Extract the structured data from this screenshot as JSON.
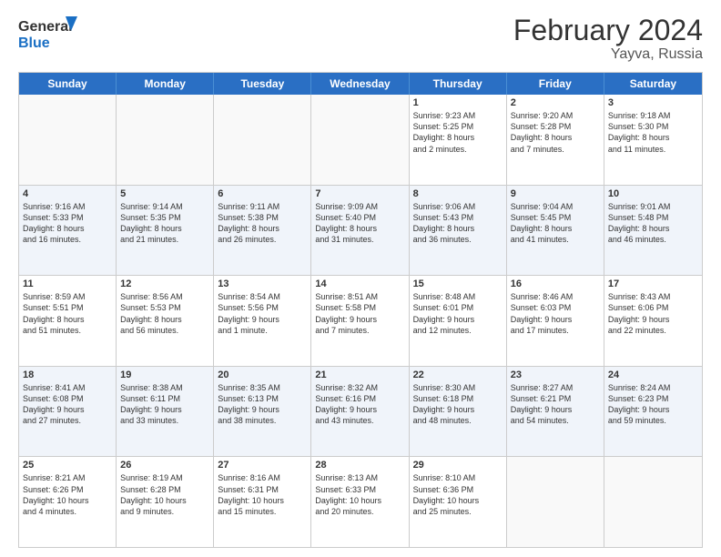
{
  "logo": {
    "line1": "General",
    "line2": "Blue"
  },
  "title": "February 2024",
  "location": "Yayva, Russia",
  "header_days": [
    "Sunday",
    "Monday",
    "Tuesday",
    "Wednesday",
    "Thursday",
    "Friday",
    "Saturday"
  ],
  "rows": [
    [
      {
        "day": "",
        "info": ""
      },
      {
        "day": "",
        "info": ""
      },
      {
        "day": "",
        "info": ""
      },
      {
        "day": "",
        "info": ""
      },
      {
        "day": "1",
        "info": "Sunrise: 9:23 AM\nSunset: 5:25 PM\nDaylight: 8 hours\nand 2 minutes."
      },
      {
        "day": "2",
        "info": "Sunrise: 9:20 AM\nSunset: 5:28 PM\nDaylight: 8 hours\nand 7 minutes."
      },
      {
        "day": "3",
        "info": "Sunrise: 9:18 AM\nSunset: 5:30 PM\nDaylight: 8 hours\nand 11 minutes."
      }
    ],
    [
      {
        "day": "4",
        "info": "Sunrise: 9:16 AM\nSunset: 5:33 PM\nDaylight: 8 hours\nand 16 minutes."
      },
      {
        "day": "5",
        "info": "Sunrise: 9:14 AM\nSunset: 5:35 PM\nDaylight: 8 hours\nand 21 minutes."
      },
      {
        "day": "6",
        "info": "Sunrise: 9:11 AM\nSunset: 5:38 PM\nDaylight: 8 hours\nand 26 minutes."
      },
      {
        "day": "7",
        "info": "Sunrise: 9:09 AM\nSunset: 5:40 PM\nDaylight: 8 hours\nand 31 minutes."
      },
      {
        "day": "8",
        "info": "Sunrise: 9:06 AM\nSunset: 5:43 PM\nDaylight: 8 hours\nand 36 minutes."
      },
      {
        "day": "9",
        "info": "Sunrise: 9:04 AM\nSunset: 5:45 PM\nDaylight: 8 hours\nand 41 minutes."
      },
      {
        "day": "10",
        "info": "Sunrise: 9:01 AM\nSunset: 5:48 PM\nDaylight: 8 hours\nand 46 minutes."
      }
    ],
    [
      {
        "day": "11",
        "info": "Sunrise: 8:59 AM\nSunset: 5:51 PM\nDaylight: 8 hours\nand 51 minutes."
      },
      {
        "day": "12",
        "info": "Sunrise: 8:56 AM\nSunset: 5:53 PM\nDaylight: 8 hours\nand 56 minutes."
      },
      {
        "day": "13",
        "info": "Sunrise: 8:54 AM\nSunset: 5:56 PM\nDaylight: 9 hours\nand 1 minute."
      },
      {
        "day": "14",
        "info": "Sunrise: 8:51 AM\nSunset: 5:58 PM\nDaylight: 9 hours\nand 7 minutes."
      },
      {
        "day": "15",
        "info": "Sunrise: 8:48 AM\nSunset: 6:01 PM\nDaylight: 9 hours\nand 12 minutes."
      },
      {
        "day": "16",
        "info": "Sunrise: 8:46 AM\nSunset: 6:03 PM\nDaylight: 9 hours\nand 17 minutes."
      },
      {
        "day": "17",
        "info": "Sunrise: 8:43 AM\nSunset: 6:06 PM\nDaylight: 9 hours\nand 22 minutes."
      }
    ],
    [
      {
        "day": "18",
        "info": "Sunrise: 8:41 AM\nSunset: 6:08 PM\nDaylight: 9 hours\nand 27 minutes."
      },
      {
        "day": "19",
        "info": "Sunrise: 8:38 AM\nSunset: 6:11 PM\nDaylight: 9 hours\nand 33 minutes."
      },
      {
        "day": "20",
        "info": "Sunrise: 8:35 AM\nSunset: 6:13 PM\nDaylight: 9 hours\nand 38 minutes."
      },
      {
        "day": "21",
        "info": "Sunrise: 8:32 AM\nSunset: 6:16 PM\nDaylight: 9 hours\nand 43 minutes."
      },
      {
        "day": "22",
        "info": "Sunrise: 8:30 AM\nSunset: 6:18 PM\nDaylight: 9 hours\nand 48 minutes."
      },
      {
        "day": "23",
        "info": "Sunrise: 8:27 AM\nSunset: 6:21 PM\nDaylight: 9 hours\nand 54 minutes."
      },
      {
        "day": "24",
        "info": "Sunrise: 8:24 AM\nSunset: 6:23 PM\nDaylight: 9 hours\nand 59 minutes."
      }
    ],
    [
      {
        "day": "25",
        "info": "Sunrise: 8:21 AM\nSunset: 6:26 PM\nDaylight: 10 hours\nand 4 minutes."
      },
      {
        "day": "26",
        "info": "Sunrise: 8:19 AM\nSunset: 6:28 PM\nDaylight: 10 hours\nand 9 minutes."
      },
      {
        "day": "27",
        "info": "Sunrise: 8:16 AM\nSunset: 6:31 PM\nDaylight: 10 hours\nand 15 minutes."
      },
      {
        "day": "28",
        "info": "Sunrise: 8:13 AM\nSunset: 6:33 PM\nDaylight: 10 hours\nand 20 minutes."
      },
      {
        "day": "29",
        "info": "Sunrise: 8:10 AM\nSunset: 6:36 PM\nDaylight: 10 hours\nand 25 minutes."
      },
      {
        "day": "",
        "info": ""
      },
      {
        "day": "",
        "info": ""
      }
    ]
  ]
}
